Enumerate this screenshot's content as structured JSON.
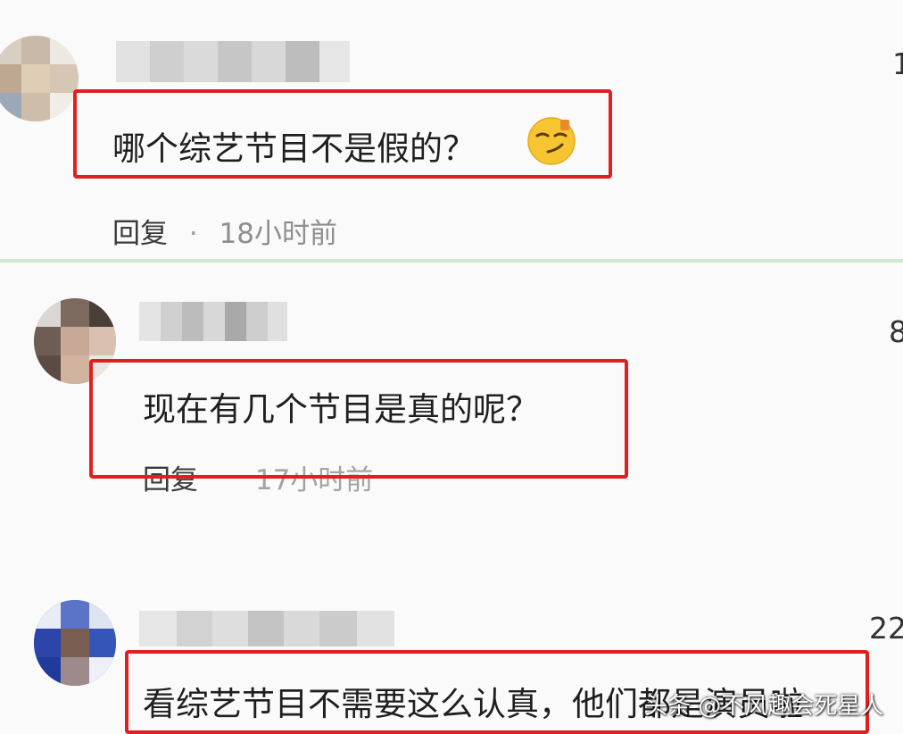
{
  "comments": [
    {
      "text": "哪个综艺节目不是假的？",
      "reply_label": "回复",
      "separator": "·",
      "time": "18小时前",
      "like_count": "1",
      "emoji": "smirk-emoji"
    },
    {
      "text": "现在有几个节目是真的呢？",
      "reply_label": "回复",
      "time": "17小时前",
      "like_count": "8"
    },
    {
      "text": "看综艺节目不需要这么认真，他们都是演员啦",
      "like_count": "22"
    }
  ],
  "watermark": "头条 @不风趣会死星人",
  "colors": {
    "highlight_box": "#e02020",
    "divider": "#cfe6cf",
    "time_text": "#8e8e8e"
  }
}
